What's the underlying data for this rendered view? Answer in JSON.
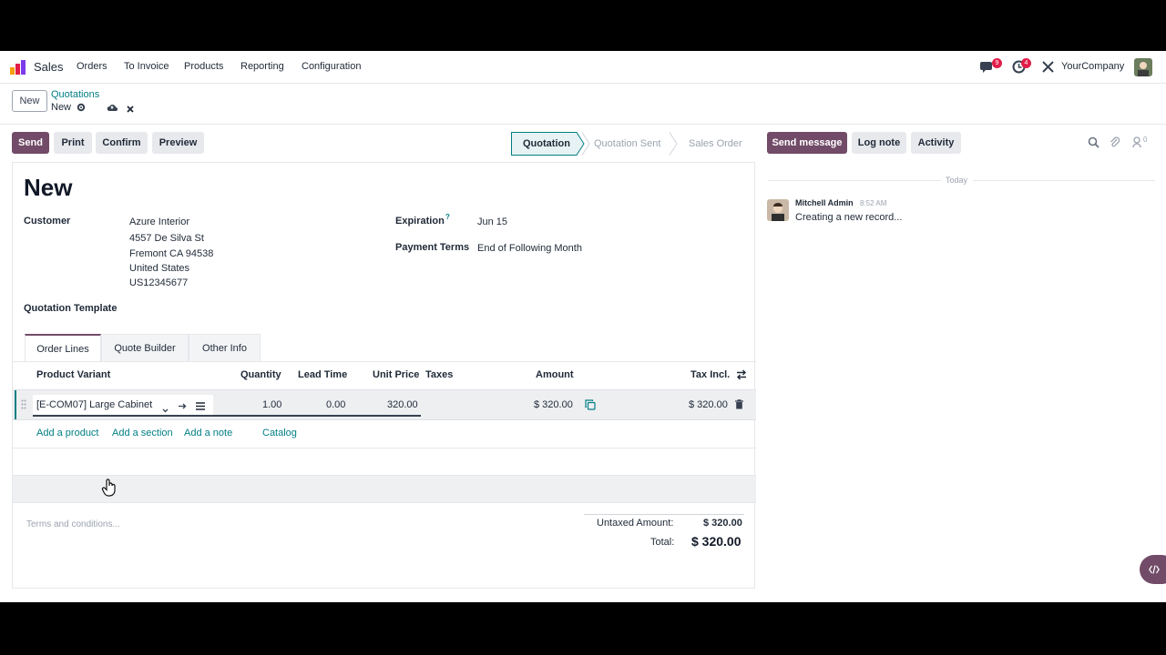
{
  "navbar": {
    "app": "Sales",
    "menu": [
      "Orders",
      "To Invoice",
      "Products",
      "Reporting",
      "Configuration"
    ],
    "messages_count": "9",
    "activities_count": "4",
    "company": "YourCompany"
  },
  "control": {
    "new_label": "New",
    "breadcrumb_parent": "Quotations",
    "breadcrumb_current": "New"
  },
  "actions": {
    "send": "Send",
    "print": "Print",
    "confirm": "Confirm",
    "preview": "Preview"
  },
  "statusbar": {
    "stages": [
      "Quotation",
      "Quotation Sent",
      "Sales Order"
    ],
    "active": "Quotation"
  },
  "chatter_actions": {
    "send_message": "Send message",
    "log_note": "Log note",
    "activity": "Activity",
    "followers_count": "0"
  },
  "form": {
    "title": "New",
    "customer_label": "Customer",
    "customer_lines": [
      "Azure Interior",
      "4557 De Silva St",
      "Fremont CA 94538",
      "United States",
      "US12345677"
    ],
    "expiration_label": "Expiration",
    "expiration_help": "?",
    "expiration_value": "Jun 15",
    "payment_terms_label": "Payment Terms",
    "payment_terms_value": "End of Following Month",
    "template_label": "Quotation Template"
  },
  "tabs": [
    "Order Lines",
    "Quote Builder",
    "Other Info"
  ],
  "order_lines": {
    "columns": {
      "product": "Product Variant",
      "quantity": "Quantity",
      "lead_time": "Lead Time",
      "unit_price": "Unit Price",
      "taxes": "Taxes",
      "amount": "Amount",
      "tax_incl": "Tax Incl."
    },
    "rows": [
      {
        "product": "[E-COM07] Large Cabinet",
        "quantity": "1.00",
        "lead_time": "0.00",
        "unit_price": "320.00",
        "amount": "$ 320.00",
        "tax_incl": "$ 320.00"
      }
    ],
    "links": [
      "Add a product",
      "Add a section",
      "Add a note",
      "Catalog"
    ]
  },
  "footer": {
    "terms_placeholder": "Terms and conditions...",
    "untaxed_label": "Untaxed Amount:",
    "untaxed_value": "$ 320.00",
    "total_label": "Total:",
    "total_value": "$ 320.00"
  },
  "chatter": {
    "date": "Today",
    "author": "Mitchell Admin",
    "time": "8:52 AM",
    "message": "Creating a new record..."
  },
  "colors": {
    "brand": "#714b67",
    "link": "#017e84",
    "badge": "#e11d48"
  }
}
